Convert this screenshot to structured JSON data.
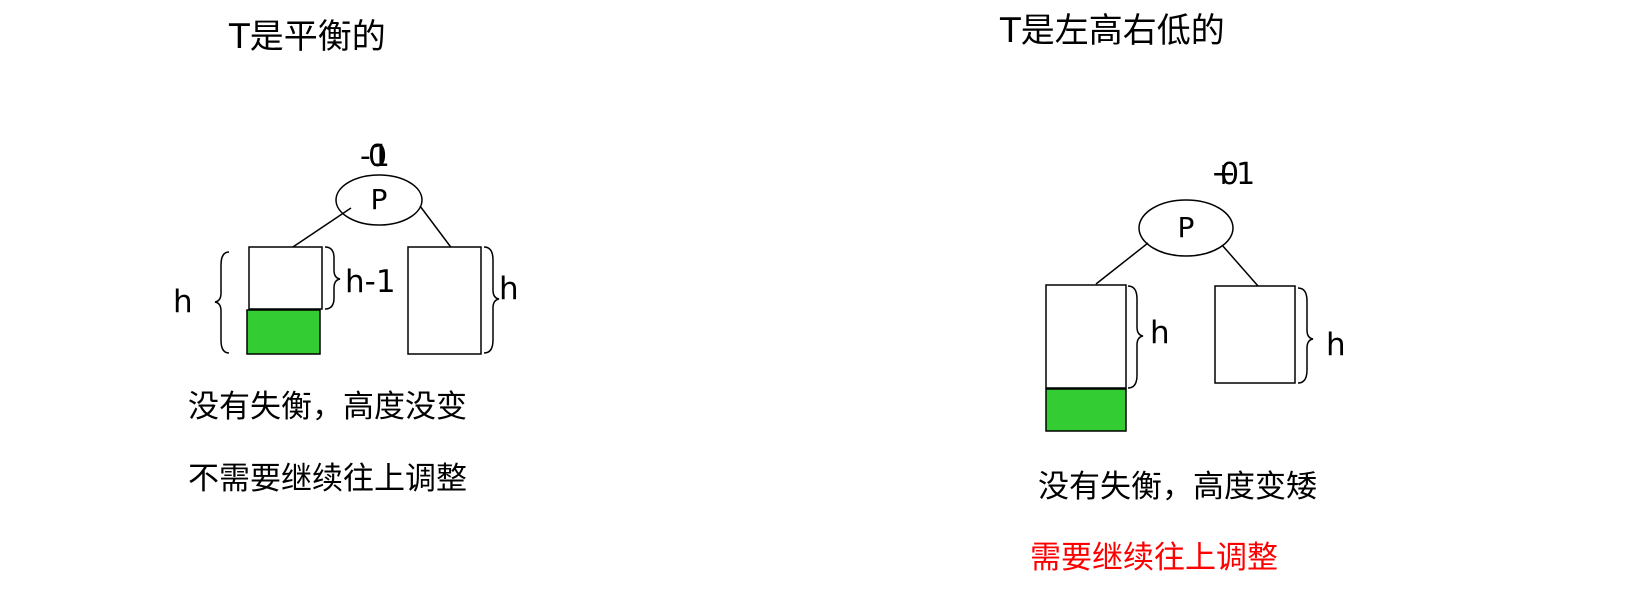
{
  "left": {
    "title": "T是平衡的",
    "balance_old": "-1",
    "balance_new": "0",
    "node": "P",
    "left_height_total": "h",
    "left_subtree_height": "h-1",
    "right_subtree_height": "h",
    "caption_line1": "没有失衡，高度没变",
    "caption_line2": "不需要继续往上调整"
  },
  "right": {
    "title": "T是左高右低的",
    "balance_old": "+1",
    "balance_new": "0",
    "node": "P",
    "left_subtree_height": "h",
    "right_subtree_height": "h",
    "caption_line1": "没有失衡，高度变矮",
    "caption_line2": "需要继续往上调整"
  },
  "colors": {
    "inserted_block": "#33cc33",
    "highlight_text": "#ff0000",
    "stroke": "#000000"
  }
}
